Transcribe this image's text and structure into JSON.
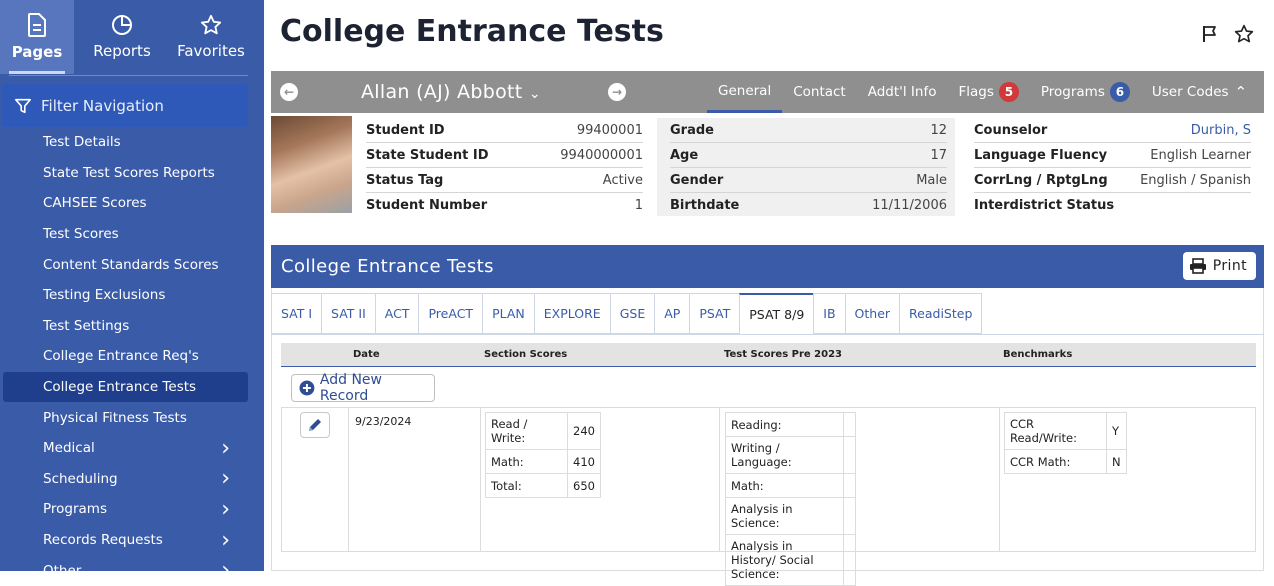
{
  "sidebar": {
    "tabs": [
      {
        "label": "Pages",
        "icon": "document-icon"
      },
      {
        "label": "Reports",
        "icon": "pie-chart-icon"
      },
      {
        "label": "Favorites",
        "icon": "star-icon"
      }
    ],
    "filter_label": "Filter Navigation",
    "items": [
      {
        "label": "Test Details"
      },
      {
        "label": "State Test Scores Reports"
      },
      {
        "label": "CAHSEE Scores"
      },
      {
        "label": "Test Scores"
      },
      {
        "label": "Content Standards Scores"
      },
      {
        "label": "Testing Exclusions"
      },
      {
        "label": "Test Settings"
      },
      {
        "label": "College Entrance Req's"
      },
      {
        "label": "College Entrance Tests",
        "active": true
      },
      {
        "label": "Physical Fitness Tests"
      },
      {
        "label": "Medical",
        "chevron": true
      },
      {
        "label": "Scheduling",
        "chevron": true
      },
      {
        "label": "Programs",
        "chevron": true
      },
      {
        "label": "Records Requests",
        "chevron": true
      },
      {
        "label": "Other",
        "chevron": true
      }
    ]
  },
  "page_title": "College Entrance Tests",
  "student": {
    "name": "Allan (AJ) Abbott",
    "tabs": [
      {
        "label": "General",
        "active": true
      },
      {
        "label": "Contact"
      },
      {
        "label": "Addt'l Info"
      },
      {
        "label": "Flags",
        "badge": "5",
        "badge_color": "#d03a3a"
      },
      {
        "label": "Programs",
        "badge": "6",
        "badge_color": "#3a5ba8"
      },
      {
        "label": "User Codes"
      }
    ],
    "col1": [
      {
        "k": "Student ID",
        "v": "99400001"
      },
      {
        "k": "State Student ID",
        "v": "9940000001"
      },
      {
        "k": "Status Tag",
        "v": "Active"
      },
      {
        "k": "Student Number",
        "v": "1"
      }
    ],
    "col2": [
      {
        "k": "Grade",
        "v": "12"
      },
      {
        "k": "Age",
        "v": "17"
      },
      {
        "k": "Gender",
        "v": "Male"
      },
      {
        "k": "Birthdate",
        "v": "11/11/2006"
      }
    ],
    "col3": [
      {
        "k": "Counselor",
        "v": "Durbin, S"
      },
      {
        "k": "Language Fluency",
        "v": "English Learner"
      },
      {
        "k": "CorrLng / RptgLng",
        "v": "English / Spanish"
      },
      {
        "k": "Interdistrict Status",
        "v": ""
      }
    ]
  },
  "section": {
    "title": "College Entrance Tests",
    "print_label": "Print",
    "test_tabs": [
      "SAT I",
      "SAT II",
      "ACT",
      "PreACT",
      "PLAN",
      "EXPLORE",
      "GSE",
      "AP",
      "PSAT",
      "PSAT 8/9",
      "IB",
      "Other",
      "ReadiStep"
    ],
    "active_tab": "PSAT 8/9",
    "columns": {
      "date": "Date",
      "section_scores": "Section Scores",
      "test_scores": "Test Scores Pre 2023",
      "benchmarks": "Benchmarks"
    },
    "add_label": "Add New Record",
    "record": {
      "date": "9/23/2024",
      "section_scores": [
        {
          "k": "Read / Write:",
          "v": "240"
        },
        {
          "k": "Math:",
          "v": "410"
        },
        {
          "k": "Total:",
          "v": "650"
        }
      ],
      "test_scores": [
        {
          "k": "Reading:",
          "v": ""
        },
        {
          "k": "Writing / Language:",
          "v": ""
        },
        {
          "k": "Math:",
          "v": ""
        },
        {
          "k": "Analysis in Science:",
          "v": ""
        },
        {
          "k": "Analysis in History/ Social Science:",
          "v": ""
        }
      ],
      "benchmarks": [
        {
          "k": "CCR Read/Write:",
          "v": "Y"
        },
        {
          "k": "CCR Math:",
          "v": "N"
        }
      ]
    }
  }
}
